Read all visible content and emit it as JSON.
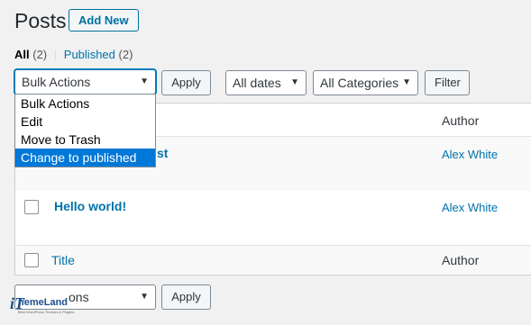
{
  "header": {
    "title": "Posts",
    "add_new_label": "Add New"
  },
  "views": {
    "all_label": "All",
    "all_count": "(2)",
    "separator": "|",
    "published_label": "Published",
    "published_count": "(2)"
  },
  "bulk_actions": {
    "selected": "Bulk Actions",
    "options": [
      "Bulk Actions",
      "Edit",
      "Move to Trash",
      "Change to published"
    ],
    "highlighted_index": 3,
    "apply_label": "Apply"
  },
  "filters": {
    "dates_selected": "All dates",
    "categories_selected": "All Categories",
    "filter_label": "Filter"
  },
  "table": {
    "columns": {
      "title": "Title",
      "author": "Author"
    },
    "rows": [
      {
        "title_partial": "st",
        "author": "Alex White"
      },
      {
        "title": "Hello world!",
        "author": "Alex White"
      }
    ]
  },
  "bottom_bulk": {
    "selected_partial": "ons",
    "apply_label": "Apply"
  },
  "watermark": {
    "brand": "hemeLand",
    "mark": "iT",
    "tagline": "Best WordPress Themes & Plugins"
  },
  "colors": {
    "link": "#0073aa",
    "highlight": "#0078d7",
    "background": "#f1f1f1"
  }
}
